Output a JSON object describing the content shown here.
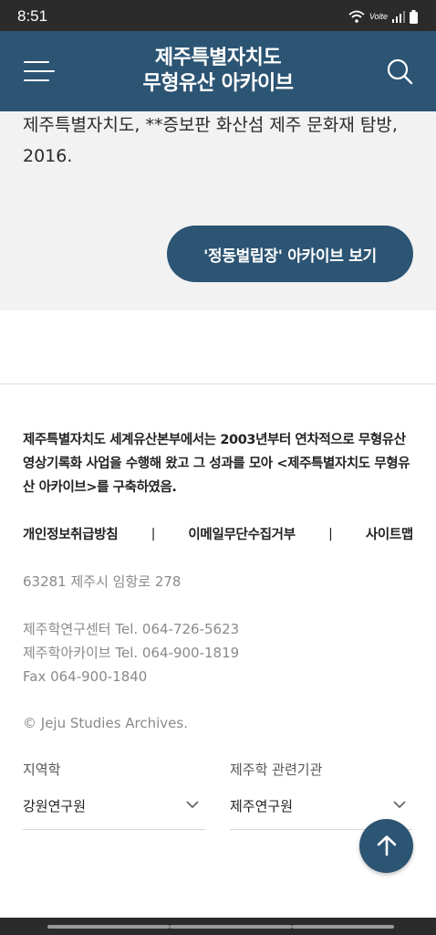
{
  "status_bar": {
    "time": "8:51",
    "network": "Volte"
  },
  "header": {
    "title_line1": "제주특별자치도",
    "title_line2": "무형유산 아카이브"
  },
  "content": {
    "text_line1": "제주특별자치도, **증보판 화산섬 제주 문화재 탐방,",
    "text_line2": "2016.",
    "archive_button_label": "'정동벌립장' 아카이브 보기"
  },
  "footer": {
    "description": "제주특별자치도 세계유산본부에서는 2003년부터 연차적으로 무형유산 영상기록화 사업을 수행해 왔고 그 성과를 모아 <제주특별자치도 무형유산 아카이브>를 구축하였음.",
    "links": [
      "개인정보취급방침",
      "이메일무단수집거부",
      "사이트맵"
    ],
    "separator": "|",
    "address": "63281 제주시 임항로 278",
    "tel1": "제주학연구센터 Tel. 064-726-5623",
    "tel2": "제주학아카이브 Tel. 064-900-1819",
    "fax": "Fax 064-900-1840",
    "copyright": "© Jeju Studies Archives.",
    "select_regional": {
      "label": "지역학",
      "value": "강원연구원"
    },
    "select_related": {
      "label": "제주학 관련기관",
      "value": "제주연구원"
    }
  },
  "colors": {
    "primary": "#2c5473",
    "content_bg": "#f2f2f2",
    "status_bar": "#2b2b2b"
  },
  "icons": {
    "menu": "hamburger-icon",
    "search": "search-icon",
    "chevron": "chevron-down-icon",
    "top": "arrow-up-icon"
  }
}
